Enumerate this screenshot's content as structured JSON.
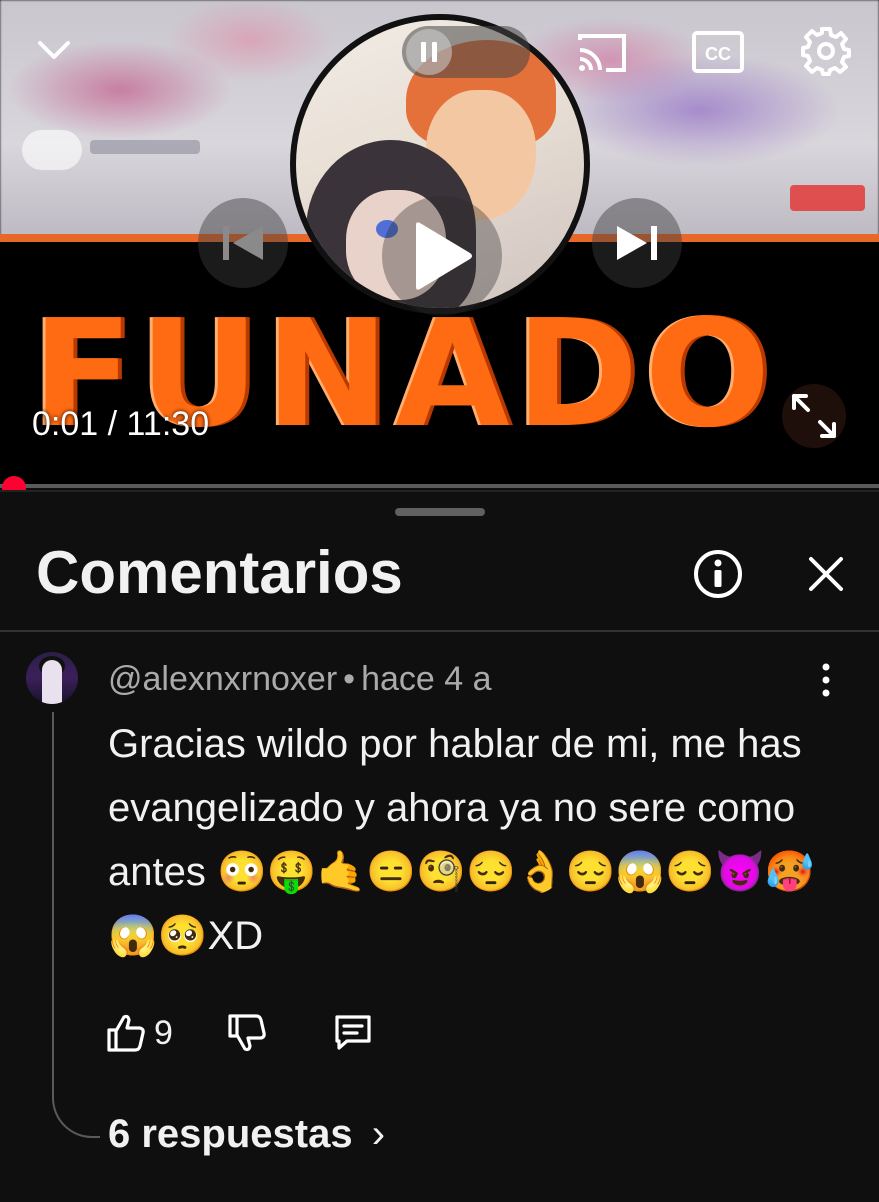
{
  "player": {
    "overlay_text": "FUNADO",
    "time_current": "0:01",
    "time_separator": "/",
    "time_total": "11:30",
    "progress_fraction": 0.001,
    "colors": {
      "overlay": "#ff6b12",
      "progress": "#ff0033"
    },
    "icons": [
      "chevron-down-icon",
      "pause-icon",
      "cast-icon",
      "captions-icon",
      "settings-icon",
      "previous-icon",
      "play-icon",
      "next-icon",
      "fullscreen-icon"
    ]
  },
  "comments": {
    "title": "Comentarios",
    "icons": [
      "info-icon",
      "close-icon"
    ],
    "items": [
      {
        "author": "@alexnxrnoxer",
        "separator": "•",
        "age": "hace 4 a",
        "text": "Gracias wildo por hablar de mi, me has evangelizado y ahora ya no sere como antes 😳🤑🤙😑🧐😔👌😔😱😔😈🥵😱🥺XD",
        "likes": "9",
        "replies_label": "6 respuestas",
        "replies_chevron": "›"
      }
    ]
  }
}
